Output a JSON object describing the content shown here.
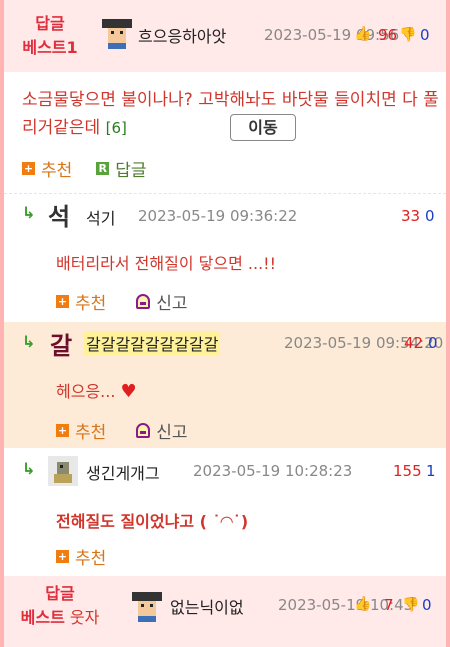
{
  "best1": {
    "tag_line1": "답글",
    "tag_line2": "베스트1",
    "nickname": "흐으응하아앗",
    "date": "2023-05-19 09:",
    "date_tail": "56",
    "up": "96",
    "down": "0"
  },
  "main_comment": {
    "text": "소금물닿으면 불이나나? 고박해놔도 바닷물 들이치면 다 풀리거같은데",
    "reply_count": "[6]",
    "move_label": "이동",
    "recommend_label": "추천",
    "reply_label": "답글"
  },
  "replies": [
    {
      "glyph": "석",
      "nickname": "석기",
      "date": "2023-05-19 09:36:22",
      "up": "33",
      "down": "0",
      "text": "배터리라서 전해질이 닿으면 ...!!",
      "recommend_label": "추천",
      "report_label": "신고"
    },
    {
      "glyph": "갈",
      "nickname": "갈갈갈갈갈갈갈갈갈",
      "date": "2023-05-19 09:5",
      "date_tail": "4:20",
      "up": "42",
      "down": "0",
      "text": "헤으응...",
      "recommend_label": "추천",
      "report_label": "신고"
    },
    {
      "nickname": "생긴게개그",
      "date": "2023-05-19 10:28:23",
      "up": "155",
      "down": "1",
      "text": "전해질도 질이었냐고 ( ",
      "text_face": "˙◠˙",
      "text_end": ")",
      "recommend_label": "추천"
    }
  ],
  "best_bottom": {
    "tag_line1": "답글",
    "tag_line2": "베스트",
    "tag_extra": "웃자",
    "nickname": "없는닉이없",
    "date": "2023-05-19 10:",
    "date_tail": "43",
    "up": "7",
    "down": "0"
  },
  "colors": {
    "best_bg": "#ffe9e9",
    "accent_red": "#e02d3c",
    "highlight_bg": "#fdebd8"
  },
  "icons": {
    "recommend": "plus-square-icon",
    "reply": "r-square-icon",
    "report": "siren-icon",
    "reply_arrow": "reply-arrow-icon",
    "thumb_up": "thumb-up-icon",
    "thumb_down": "thumb-down-icon"
  }
}
